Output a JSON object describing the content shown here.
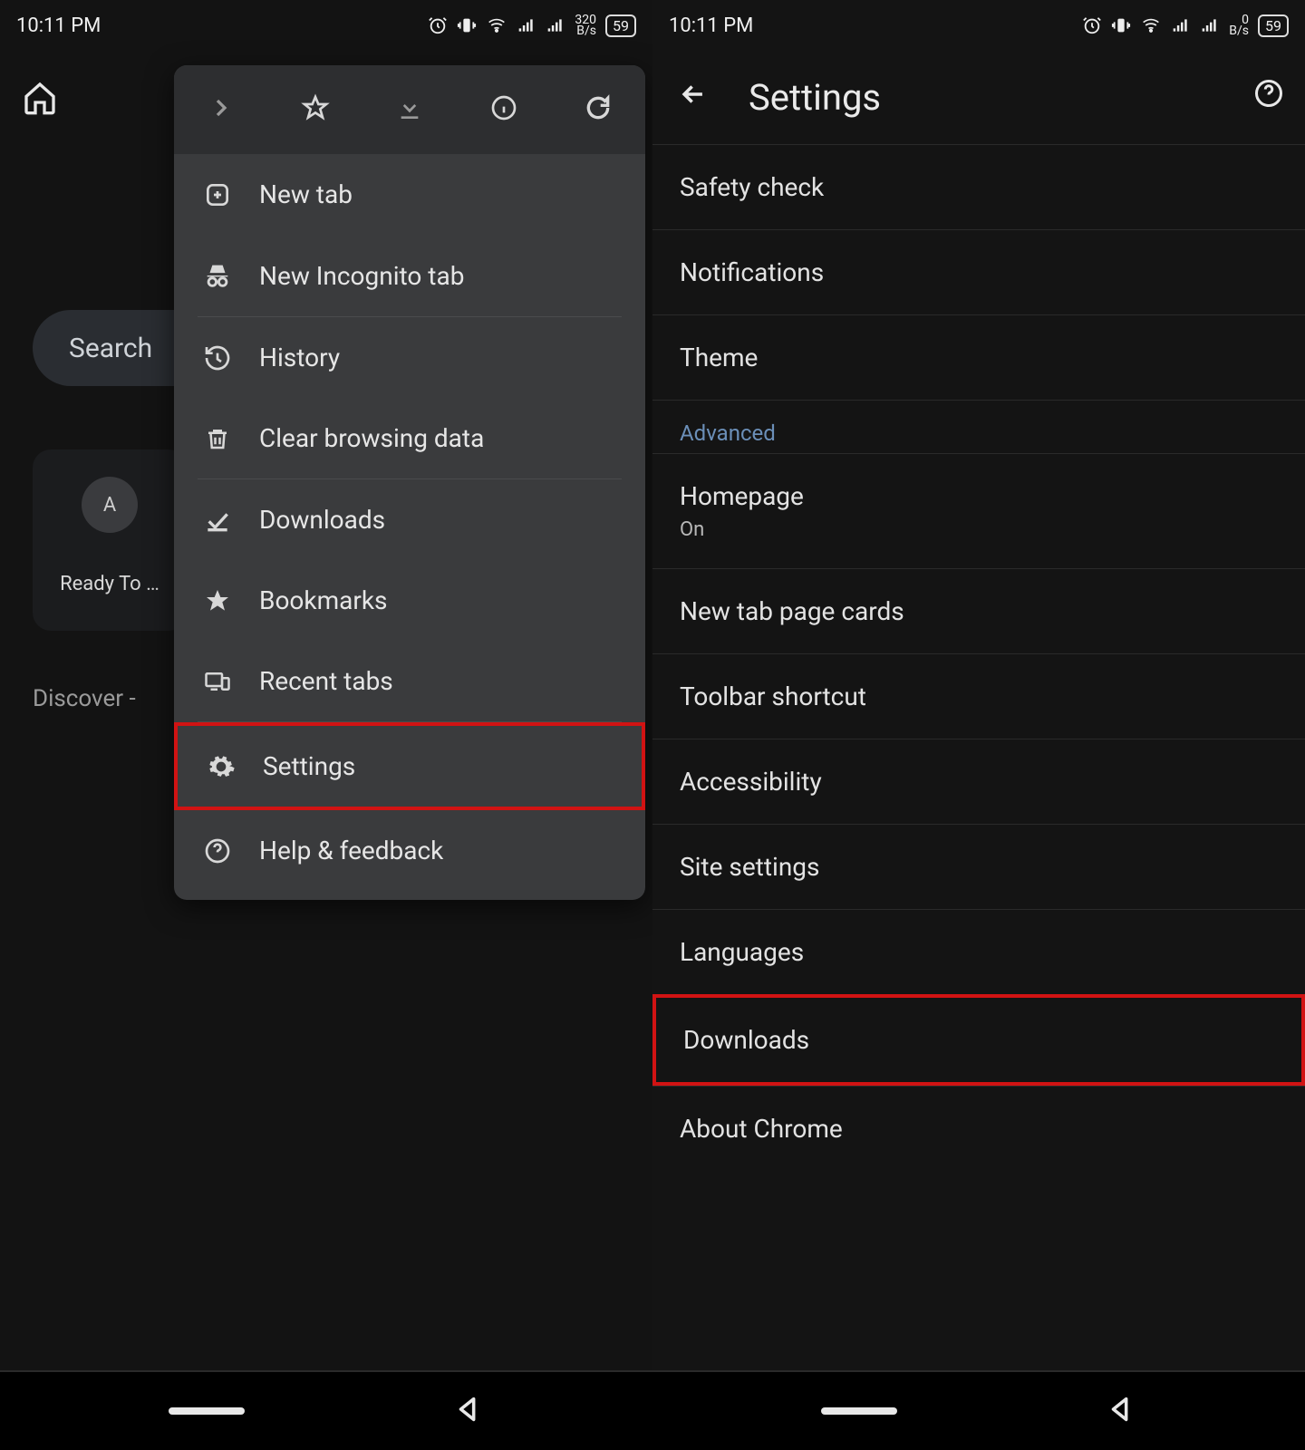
{
  "status": {
    "time": "10:11 PM",
    "rate_left_top": "320",
    "rate_left_bot": "B/s",
    "rate_right_top": "0",
    "rate_right_bot": "B/s",
    "battery": "59"
  },
  "left": {
    "search_label": "Search",
    "avatar_letter": "A",
    "ready_label": "Ready To …",
    "discover_label": "Discover -"
  },
  "menu": {
    "items": [
      {
        "icon": "plus-box",
        "label": "New tab"
      },
      {
        "icon": "incognito",
        "label": "New Incognito tab"
      },
      {
        "icon": "history",
        "label": "History"
      },
      {
        "icon": "trash",
        "label": "Clear browsing data"
      },
      {
        "icon": "download-check",
        "label": "Downloads"
      },
      {
        "icon": "star",
        "label": "Bookmarks"
      },
      {
        "icon": "devices",
        "label": "Recent tabs"
      },
      {
        "icon": "gear",
        "label": "Settings"
      },
      {
        "icon": "help",
        "label": "Help & feedback"
      }
    ]
  },
  "settings": {
    "title": "Settings",
    "rows": [
      {
        "label": "Safety check"
      },
      {
        "label": "Notifications"
      },
      {
        "label": "Theme"
      }
    ],
    "advanced_label": "Advanced",
    "advanced_rows": [
      {
        "label": "Homepage",
        "sub": "On"
      },
      {
        "label": "New tab page cards"
      },
      {
        "label": "Toolbar shortcut"
      },
      {
        "label": "Accessibility"
      },
      {
        "label": "Site settings"
      },
      {
        "label": "Languages"
      },
      {
        "label": "Downloads"
      },
      {
        "label": "About Chrome"
      }
    ]
  }
}
